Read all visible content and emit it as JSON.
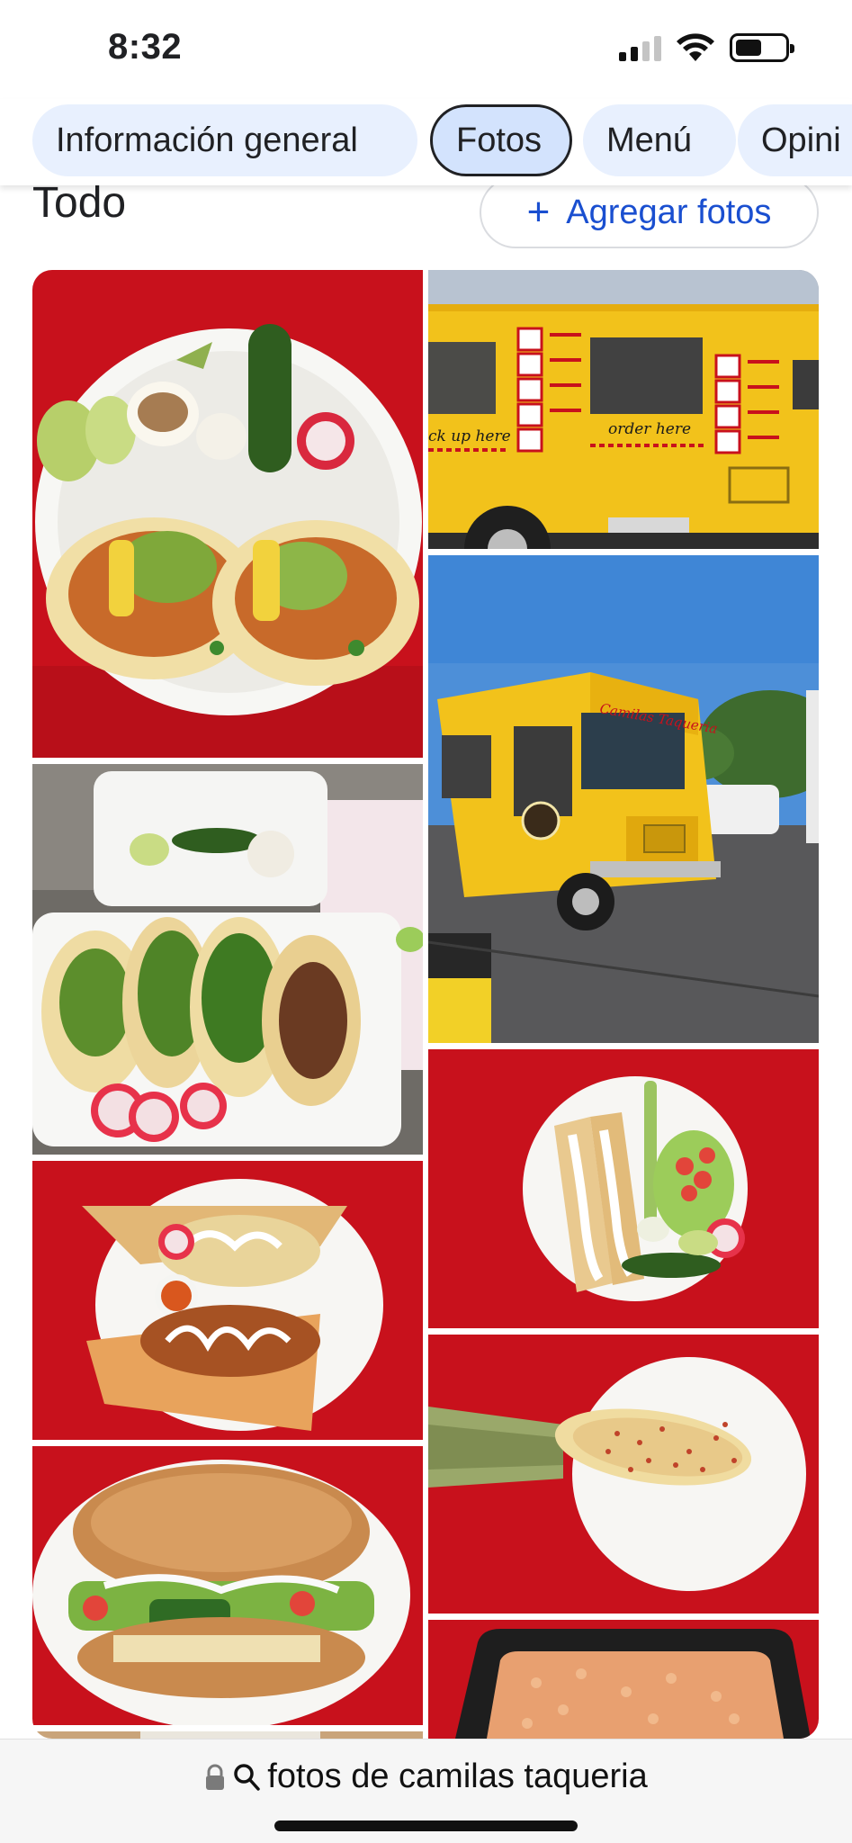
{
  "status_bar": {
    "time": "8:32",
    "icons": [
      "cellular-signal-icon",
      "wifi-icon",
      "battery-icon"
    ]
  },
  "tabs": [
    {
      "label": "Información general",
      "active": false
    },
    {
      "label": "Fotos",
      "active": true
    },
    {
      "label": "Menú",
      "active": false
    },
    {
      "label": "Opini",
      "active": false
    }
  ],
  "section": {
    "title": "Todo",
    "add_photos_label": "Agregar fotos",
    "add_photos_icon": "plus-icon"
  },
  "photos": [
    {
      "name": "photo-tacos-plate",
      "subject": "tacos al pastor on plate"
    },
    {
      "name": "photo-food-truck-side",
      "subject": "yellow food truck side"
    },
    {
      "name": "photo-food-truck-front",
      "subject": "yellow food truck front"
    },
    {
      "name": "photo-tacos-takeout",
      "subject": "tacos in takeout box"
    },
    {
      "name": "photo-flautas",
      "subject": "flautas with salad"
    },
    {
      "name": "photo-tamales",
      "subject": "tamales on plate"
    },
    {
      "name": "photo-elote",
      "subject": "elote with chili"
    },
    {
      "name": "photo-torta",
      "subject": "torta sandwich"
    },
    {
      "name": "photo-rice",
      "subject": "mexican rice"
    },
    {
      "name": "photo-partial",
      "subject": "cut off photo"
    }
  ],
  "truck_signs": {
    "pickup": "ck up here",
    "order": "order here",
    "brand": "Camilas Taqueria"
  },
  "address_bar": {
    "query": "fotos de camilas taqueria",
    "icons": [
      "lock-icon",
      "search-icon"
    ]
  },
  "colors": {
    "tab_bg": "#e8f0fe",
    "tab_active_bg": "#d3e3fd",
    "link_blue": "#1a4fd0",
    "truck_yellow": "#f2c21b",
    "tablecloth_red": "#c8111c"
  }
}
